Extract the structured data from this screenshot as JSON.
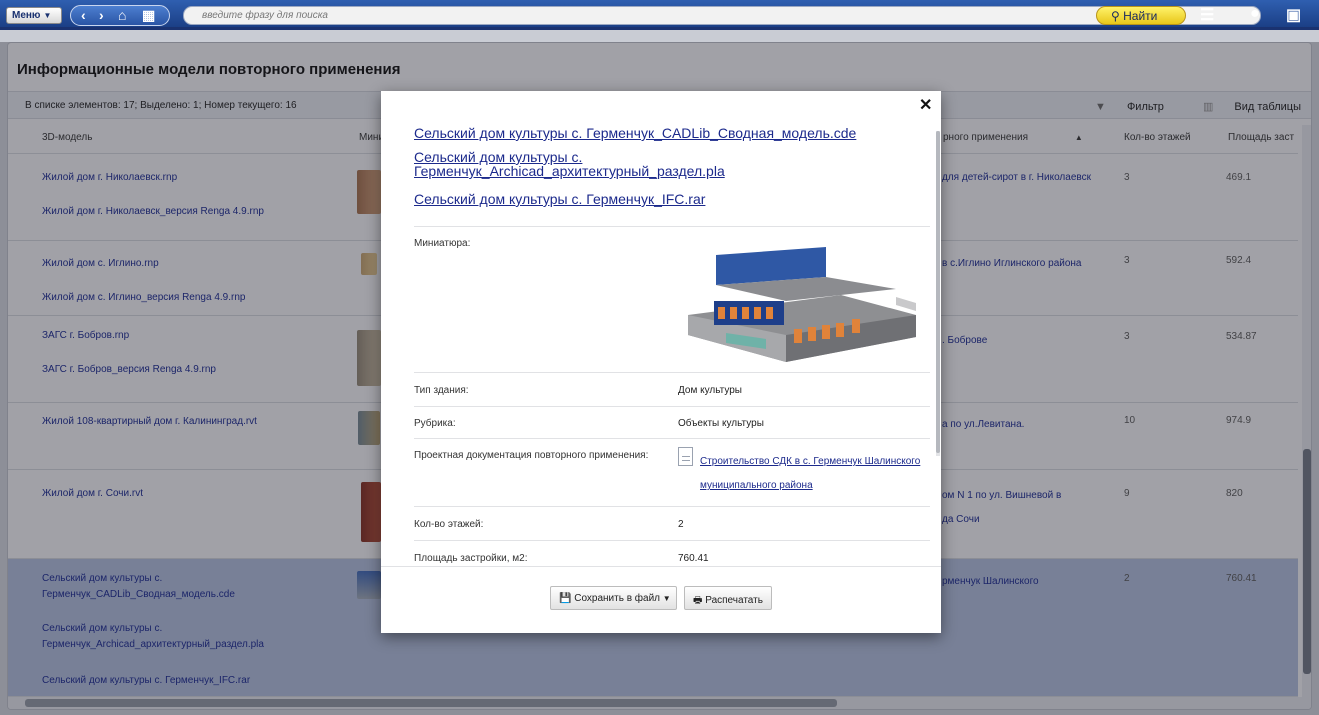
{
  "topbar": {
    "menu_label": "Меню",
    "search_placeholder": "введите фразу для поиска",
    "find_label": "Найти"
  },
  "page": {
    "title": "Информационные модели повторного применения",
    "status": "В списке элементов: 17; Выделено: 1; Номер текущего: 16",
    "filter_label": "Фильтр",
    "view_label": "Вид таблицы"
  },
  "table": {
    "columns": [
      "3D-модель",
      "Мини",
      "рного применения",
      "Кол-во этажей",
      "Площадь заст"
    ],
    "rows": [
      {
        "files": [
          "Жилой дом г. Николаевск.rnp",
          "Жилой дом г. Николаевск_версия Renga 4.9.rnp"
        ],
        "doc": "для детей-сирот в г. Николаевск",
        "floors": "3",
        "area": "469.1"
      },
      {
        "files": [
          "Жилой дом с. Иглино.rnp",
          "Жилой дом с. Иглино_версия Renga 4.9.rnp"
        ],
        "doc": "в с.Иглино Иглинского района",
        "floors": "3",
        "area": "592.4"
      },
      {
        "files": [
          "ЗАГС г. Бобров.rnp",
          "ЗАГС г. Бобров_версия Renga 4.9.rnp"
        ],
        "doc": ". Боброве",
        "floors": "3",
        "area": "534.87"
      },
      {
        "files": [
          "Жилой 108-квартирный дом г. Калининград.rvt"
        ],
        "doc": "а по ул.Левитана.",
        "floors": "10",
        "area": "974.9"
      },
      {
        "files": [
          "Жилой дом г. Сочи.rvt"
        ],
        "doc": "ом N 1 по ул. Вишневой в",
        "doc2": "да Сочи",
        "floors": "9",
        "area": "820"
      },
      {
        "files": [
          "Сельский дом культуры с.",
          "Герменчук_CADLib_Сводная_модель.cde",
          "Сельский дом культуры с.",
          "Герменчук_Archicad_архитектурный_раздел.pla",
          "Сельский дом культуры с. Герменчук_IFC.rar"
        ],
        "doc": "рменчук Шалинского",
        "floors": "2",
        "area": "760.41"
      }
    ]
  },
  "modal": {
    "files": [
      "Сельский дом культуры с. Герменчук_CADLib_Сводная_модель.cde",
      "Сельский дом культуры с.",
      "Герменчук_Archicad_архитектурный_раздел.pla",
      "Сельский дом культуры с. Герменчук_IFC.rar"
    ],
    "thumb_label": "Миниатюра:",
    "props": [
      {
        "label": "Тип здания:",
        "value": "Дом культуры"
      },
      {
        "label": "Рубрика:",
        "value": "Объекты культуры"
      },
      {
        "label": "Проектная документация повторного применения:",
        "value": "Строительство СДК в с. Герменчук Шалинского",
        "value2": "муниципального района"
      },
      {
        "label": "Кол-во этажей:",
        "value": "2"
      },
      {
        "label": "Площадь застройки, м2:",
        "value": "760.41"
      }
    ],
    "save_label": "Сохранить в файл",
    "print_label": "Распечатать"
  }
}
